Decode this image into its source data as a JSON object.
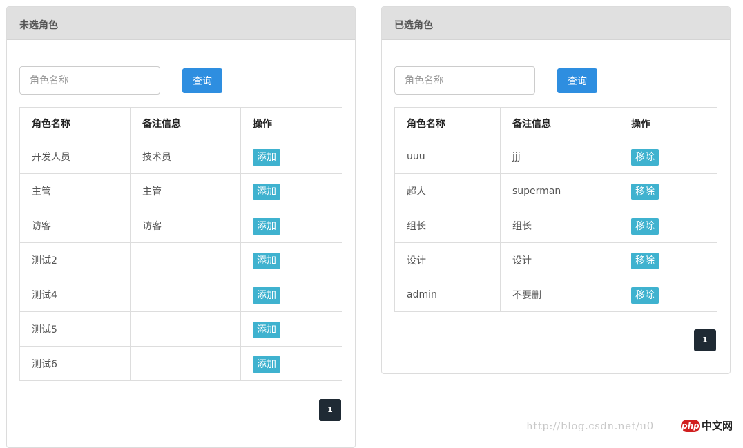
{
  "left_panel": {
    "title": "未选角色",
    "search_placeholder": "角色名称",
    "query_label": "查询",
    "columns": [
      "角色名称",
      "备注信息",
      "操作"
    ],
    "rows": [
      {
        "name": "开发人员",
        "note": "技术员",
        "action": "添加"
      },
      {
        "name": "主管",
        "note": "主管",
        "action": "添加"
      },
      {
        "name": "访客",
        "note": "访客",
        "action": "添加"
      },
      {
        "name": "测试2",
        "note": "",
        "action": "添加"
      },
      {
        "name": "测试4",
        "note": "",
        "action": "添加"
      },
      {
        "name": "测试5",
        "note": "",
        "action": "添加"
      },
      {
        "name": "测试6",
        "note": "",
        "action": "添加"
      }
    ],
    "page": "1"
  },
  "right_panel": {
    "title": "已选角色",
    "search_placeholder": "角色名称",
    "query_label": "查询",
    "columns": [
      "角色名称",
      "备注信息",
      "操作"
    ],
    "rows": [
      {
        "name": "uuu",
        "note": "jjj",
        "action": "移除"
      },
      {
        "name": "超人",
        "note": "superman",
        "action": "移除"
      },
      {
        "name": "组长",
        "note": "组长",
        "action": "移除"
      },
      {
        "name": "设计",
        "note": "设计",
        "action": "移除"
      },
      {
        "name": "admin",
        "note": "不要删",
        "action": "移除"
      }
    ],
    "page": "1"
  },
  "watermark": {
    "url_text": "http://blog.csdn.net/u0",
    "logo_php": "php",
    "logo_cn": "中文网"
  },
  "colors": {
    "header_bg": "#e0e0e0",
    "primary": "#2e8ee0",
    "action": "#3fb2cf",
    "pager": "#1f2a34"
  }
}
